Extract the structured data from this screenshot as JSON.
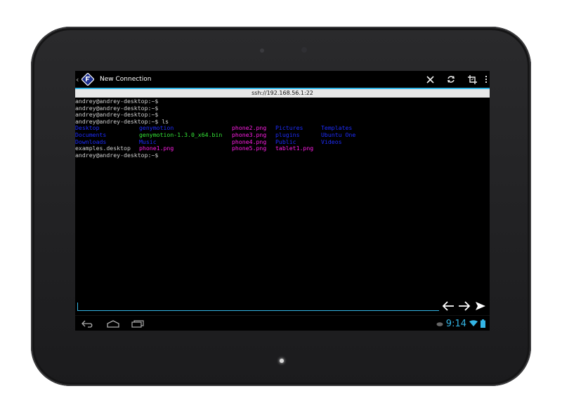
{
  "app": {
    "title": "New Connection",
    "host": "ssh://192.168.56.1:22"
  },
  "terminal": {
    "prompt_lines": [
      "andrey@andrey-desktop:~$",
      "andrey@andrey-desktop:~$",
      "andrey@andrey-desktop:~$",
      "andrey@andrey-desktop:~$ ls"
    ],
    "ls_rows": [
      [
        {
          "text": "Desktop",
          "color": "#1e2dff"
        },
        {
          "text": "genymotion",
          "color": "#1e2dff"
        },
        {
          "text": "phone2.png",
          "color": "#ff1ee6"
        },
        {
          "text": "Pictures",
          "color": "#1e2dff"
        },
        {
          "text": "Templates",
          "color": "#1e2dff"
        }
      ],
      [
        {
          "text": "Documents",
          "color": "#1e2dff"
        },
        {
          "text": "genymotion-1.3.0_x64.bin",
          "color": "#35e838"
        },
        {
          "text": "phone3.png",
          "color": "#ff1ee6"
        },
        {
          "text": "plugins",
          "color": "#1e2dff"
        },
        {
          "text": "Ubuntu One",
          "color": "#1e2dff"
        }
      ],
      [
        {
          "text": "Downloads",
          "color": "#1e2dff"
        },
        {
          "text": "Music",
          "color": "#1e2dff"
        },
        {
          "text": "phone4.png",
          "color": "#ff1ee6"
        },
        {
          "text": "Public",
          "color": "#1e2dff"
        },
        {
          "text": "Videos",
          "color": "#1e2dff"
        }
      ],
      [
        {
          "text": "examples.desktop",
          "color": "#d0d0d0"
        },
        {
          "text": "phone1.png",
          "color": "#ff1ee6"
        },
        {
          "text": "phone5.png",
          "color": "#ff1ee6"
        },
        {
          "text": "tablet1.png",
          "color": "#ff1ee6"
        },
        {
          "text": "",
          "color": "#d0d0d0"
        }
      ]
    ],
    "final_prompt": "andrey@andrey-desktop:~$"
  },
  "input": {
    "value": ""
  },
  "statusbar": {
    "time": "9:14"
  },
  "icons": {
    "close": "close-icon",
    "refresh": "refresh-icon",
    "resize": "crop-icon",
    "overflow": "overflow-menu-icon",
    "left": "arrow-left-icon",
    "right": "arrow-right-icon",
    "send": "send-icon"
  },
  "colors": {
    "accent": "#33b5e5"
  }
}
